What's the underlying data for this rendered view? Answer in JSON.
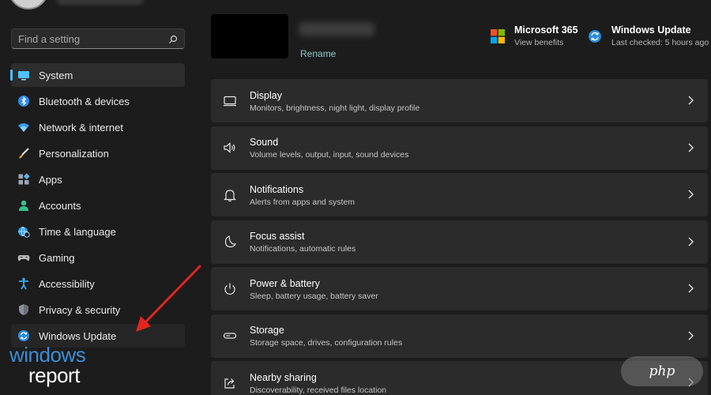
{
  "search": {
    "placeholder": "Find a setting"
  },
  "sidebar": {
    "items": [
      {
        "label": "System",
        "icon": "monitor-icon",
        "active": true
      },
      {
        "label": "Bluetooth & devices",
        "icon": "bluetooth-icon"
      },
      {
        "label": "Network & internet",
        "icon": "wifi-icon"
      },
      {
        "label": "Personalization",
        "icon": "brush-icon"
      },
      {
        "label": "Apps",
        "icon": "apps-icon"
      },
      {
        "label": "Accounts",
        "icon": "person-icon"
      },
      {
        "label": "Time & language",
        "icon": "globe-clock-icon"
      },
      {
        "label": "Gaming",
        "icon": "gamepad-icon"
      },
      {
        "label": "Accessibility",
        "icon": "accessibility-icon"
      },
      {
        "label": "Privacy & security",
        "icon": "shield-icon"
      },
      {
        "label": "Windows Update",
        "icon": "update-icon"
      }
    ]
  },
  "header": {
    "rename_label": "Rename",
    "m365": {
      "title": "Microsoft 365",
      "subtitle": "View benefits",
      "icon": "microsoft-logo-icon"
    },
    "windows_update": {
      "title": "Windows Update",
      "subtitle": "Last checked: 5 hours ago",
      "icon": "update-icon"
    }
  },
  "main": {
    "rows": [
      {
        "title": "Display",
        "subtitle": "Monitors, brightness, night light, display profile",
        "icon": "display-icon"
      },
      {
        "title": "Sound",
        "subtitle": "Volume levels, output, input, sound devices",
        "icon": "speaker-icon"
      },
      {
        "title": "Notifications",
        "subtitle": "Alerts from apps and system",
        "icon": "bell-icon"
      },
      {
        "title": "Focus assist",
        "subtitle": "Notifications, automatic rules",
        "icon": "moon-icon"
      },
      {
        "title": "Power & battery",
        "subtitle": "Sleep, battery usage, battery saver",
        "icon": "power-icon"
      },
      {
        "title": "Storage",
        "subtitle": "Storage space, drives, configuration rules",
        "icon": "storage-icon"
      },
      {
        "title": "Nearby sharing",
        "subtitle": "Discoverability, received files location",
        "icon": "share-icon"
      }
    ]
  },
  "watermark": {
    "brand_line1": "windows",
    "brand_line2": "report",
    "php_label": "php"
  },
  "colors": {
    "accent": "#4cc2ff",
    "background": "#1c1c1c",
    "card": "#2b2b2b",
    "annotation_arrow": "#e0261f"
  }
}
